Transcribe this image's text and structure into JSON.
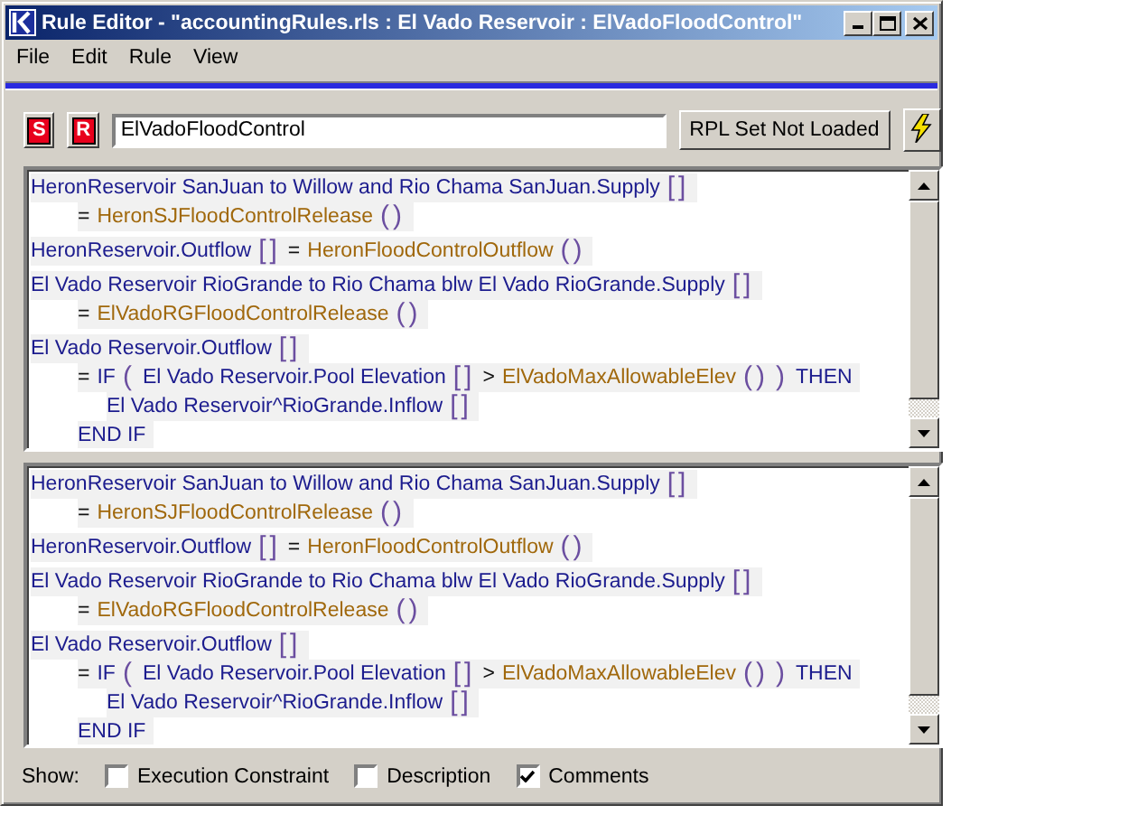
{
  "window": {
    "title": "Rule Editor - \"accountingRules.rls : El Vado Reservoir : ElVadoFloodControl\""
  },
  "menu": [
    "File",
    "Edit",
    "Rule",
    "View"
  ],
  "toolbar": {
    "buttons": [
      {
        "label": "S"
      },
      {
        "label": "R"
      }
    ],
    "rule_name": "ElVadoFloodControl",
    "status_button": "RPL Set Not Loaded"
  },
  "panes": [
    {
      "statements": [
        {
          "tokens": [
            {
              "kind": "slot",
              "text": "HeronReservoir SanJuan to Willow and Rio Chama SanJuan.Supply"
            },
            {
              "kind": "brackets",
              "text": "[]"
            }
          ],
          "children": [
            {
              "tokens": [
                {
                  "kind": "operator",
                  "text": "="
                },
                {
                  "kind": "function",
                  "text": "HeronSJFloodControlRelease"
                },
                {
                  "kind": "brackets",
                  "text": "()"
                }
              ]
            }
          ]
        },
        {
          "tokens": [
            {
              "kind": "slot",
              "text": "HeronReservoir.Outflow"
            },
            {
              "kind": "brackets",
              "text": "[]"
            },
            {
              "kind": "operator",
              "text": "="
            },
            {
              "kind": "function",
              "text": "HeronFloodControlOutflow"
            },
            {
              "kind": "brackets",
              "text": "()"
            }
          ]
        },
        {
          "tokens": [
            {
              "kind": "slot",
              "text": "El Vado Reservoir RioGrande to Rio Chama blw El Vado RioGrande.Supply"
            },
            {
              "kind": "brackets",
              "text": "[]"
            }
          ],
          "children": [
            {
              "tokens": [
                {
                  "kind": "operator",
                  "text": "="
                },
                {
                  "kind": "function",
                  "text": "ElVadoRGFloodControlRelease"
                },
                {
                  "kind": "brackets",
                  "text": "()"
                }
              ]
            }
          ]
        },
        {
          "tokens": [
            {
              "kind": "slot",
              "text": "El Vado Reservoir.Outflow"
            },
            {
              "kind": "brackets",
              "text": "[]"
            }
          ],
          "children": [
            {
              "tokens": [
                {
                  "kind": "operator",
                  "text": "="
                },
                {
                  "kind": "keyword",
                  "text": "IF"
                },
                {
                  "kind": "brackets",
                  "text": "("
                },
                {
                  "kind": "slot",
                  "text": "El Vado Reservoir.Pool Elevation"
                },
                {
                  "kind": "brackets",
                  "text": "[]"
                },
                {
                  "kind": "operator",
                  "text": ">"
                },
                {
                  "kind": "function",
                  "text": "ElVadoMaxAllowableElev"
                },
                {
                  "kind": "brackets",
                  "text": "()"
                },
                {
                  "kind": "brackets",
                  "text": ")"
                },
                {
                  "kind": "keyword",
                  "text": "THEN"
                }
              ],
              "children": [
                {
                  "tokens": [
                    {
                      "kind": "slot",
                      "text": "El Vado Reservoir^RioGrande.Inflow"
                    },
                    {
                      "kind": "brackets",
                      "text": "[]"
                    }
                  ]
                }
              ]
            },
            {
              "tokens": [
                {
                  "kind": "keyword",
                  "text": "END IF"
                }
              ]
            }
          ]
        }
      ]
    },
    {
      "statements": [
        {
          "tokens": [
            {
              "kind": "slot",
              "text": "HeronReservoir SanJuan to Willow and Rio Chama SanJuan.Supply"
            },
            {
              "kind": "brackets",
              "text": "[]"
            }
          ],
          "children": [
            {
              "tokens": [
                {
                  "kind": "operator",
                  "text": "="
                },
                {
                  "kind": "function",
                  "text": "HeronSJFloodControlRelease"
                },
                {
                  "kind": "brackets",
                  "text": "()"
                }
              ]
            }
          ]
        },
        {
          "tokens": [
            {
              "kind": "slot",
              "text": "HeronReservoir.Outflow"
            },
            {
              "kind": "brackets",
              "text": "[]"
            },
            {
              "kind": "operator",
              "text": "="
            },
            {
              "kind": "function",
              "text": "HeronFloodControlOutflow"
            },
            {
              "kind": "brackets",
              "text": "()"
            }
          ]
        },
        {
          "tokens": [
            {
              "kind": "slot",
              "text": "El Vado Reservoir RioGrande to Rio Chama blw El Vado RioGrande.Supply"
            },
            {
              "kind": "brackets",
              "text": "[]"
            }
          ],
          "children": [
            {
              "tokens": [
                {
                  "kind": "operator",
                  "text": "="
                },
                {
                  "kind": "function",
                  "text": "ElVadoRGFloodControlRelease"
                },
                {
                  "kind": "brackets",
                  "text": "()"
                }
              ]
            }
          ]
        },
        {
          "tokens": [
            {
              "kind": "slot",
              "text": "El Vado Reservoir.Outflow"
            },
            {
              "kind": "brackets",
              "text": "[]"
            }
          ],
          "children": [
            {
              "tokens": [
                {
                  "kind": "operator",
                  "text": "="
                },
                {
                  "kind": "keyword",
                  "text": "IF"
                },
                {
                  "kind": "brackets",
                  "text": "("
                },
                {
                  "kind": "slot",
                  "text": "El Vado Reservoir.Pool Elevation"
                },
                {
                  "kind": "brackets",
                  "text": "[]"
                },
                {
                  "kind": "operator",
                  "text": ">"
                },
                {
                  "kind": "function",
                  "text": "ElVadoMaxAllowableElev"
                },
                {
                  "kind": "brackets",
                  "text": "()"
                },
                {
                  "kind": "brackets",
                  "text": ")"
                },
                {
                  "kind": "keyword",
                  "text": "THEN"
                }
              ],
              "children": [
                {
                  "tokens": [
                    {
                      "kind": "slot",
                      "text": "El Vado Reservoir^RioGrande.Inflow"
                    },
                    {
                      "kind": "brackets",
                      "text": "[]"
                    }
                  ]
                }
              ]
            },
            {
              "tokens": [
                {
                  "kind": "keyword",
                  "text": "END IF"
                }
              ]
            }
          ]
        }
      ]
    }
  ],
  "show": {
    "label": "Show:",
    "options": [
      {
        "label": "Execution Constraint",
        "checked": false
      },
      {
        "label": "Description",
        "checked": false
      },
      {
        "label": "Comments",
        "checked": true
      }
    ]
  }
}
